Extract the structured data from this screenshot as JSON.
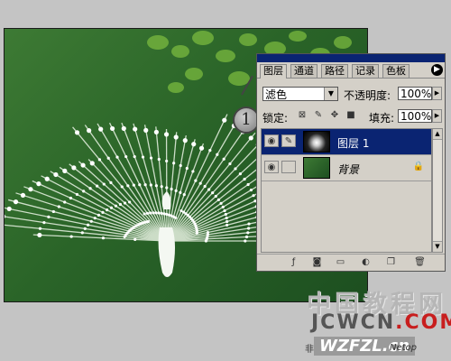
{
  "panel": {
    "tabs": [
      "图层",
      "通道",
      "路径",
      "记录",
      "色板"
    ],
    "blend_mode": "滤色",
    "opacity_label": "不透明度:",
    "opacity_value": "100%",
    "lock_label": "锁定:",
    "fill_label": "填充:",
    "fill_value": "100%",
    "layers": [
      {
        "name": "图层 1",
        "selected": true
      },
      {
        "name": "背景",
        "selected": false
      }
    ]
  },
  "callout": {
    "number": "1"
  },
  "watermark": {
    "cn": "中国教程网",
    "site_jc": "JCWCN",
    "site_dot": ".COM",
    "brand": "WZFZL.cn",
    "small1": "非主",
    "small2": "Netop"
  },
  "colors": {
    "canvas_green": "#2a6428",
    "selection_blue": "#0a2472",
    "panel_gray": "#d4d0c8"
  }
}
